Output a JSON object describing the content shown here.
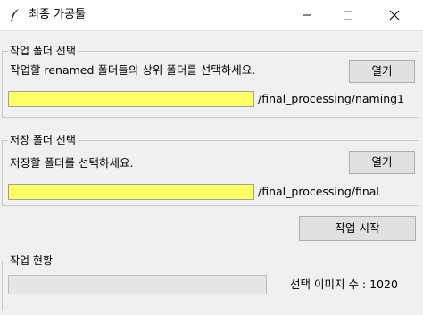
{
  "window": {
    "title": "최종 가공툴"
  },
  "work_folder": {
    "group_label": "작업 폴더 선택",
    "description": "작업할 renamed 폴더들의 상위 폴더를 선택하세요.",
    "open_button": "열기",
    "path": "/final_processing/naming1",
    "highlight_color": "#ffff66"
  },
  "save_folder": {
    "group_label": "저장 폴더 선택",
    "description": "저장할 폴더를 선택하세요.",
    "open_button": "열기",
    "path": "/final_processing/final",
    "highlight_color": "#ffff66"
  },
  "start_button": "작업 시작",
  "status": {
    "group_label": "작업 현황",
    "progress": 0,
    "count_text": "선택 이미지 수 : 1020"
  }
}
